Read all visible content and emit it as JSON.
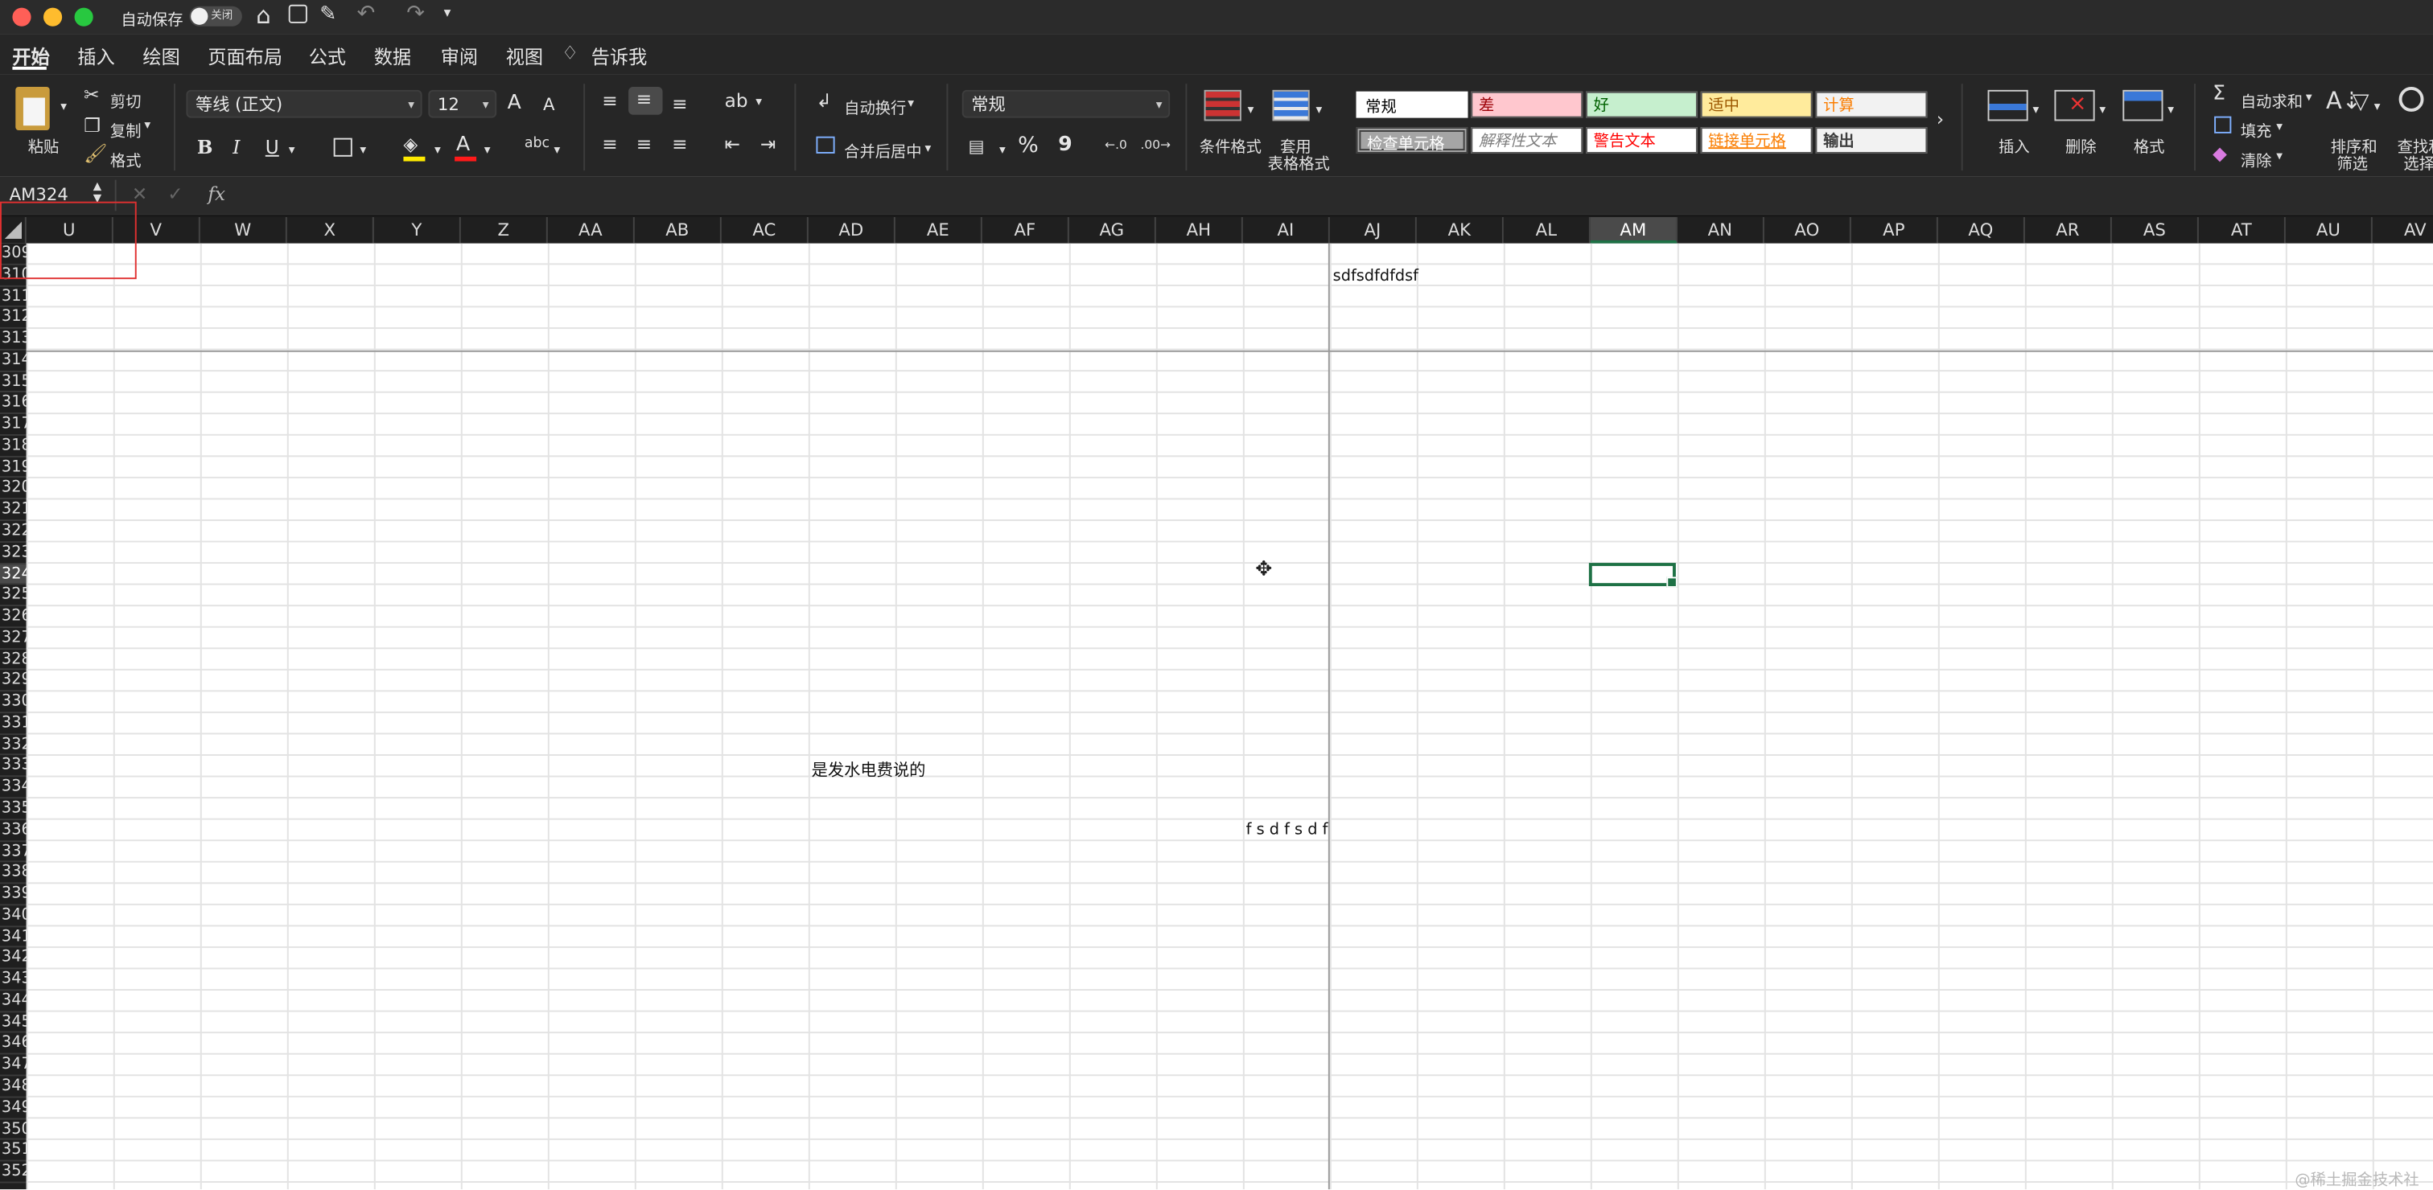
{
  "titlebar": {
    "autosave_label": "自动保存",
    "autosave_state": "关闭",
    "lights": [
      "#ff5f57",
      "#febc2e",
      "#28c840"
    ]
  },
  "tabs": [
    "开始",
    "插入",
    "绘图",
    "页面布局",
    "公式",
    "数据",
    "审阅",
    "视图"
  ],
  "tell_me": "告诉我",
  "clipboard": {
    "paste": "粘贴",
    "cut": "剪切",
    "copy": "复制",
    "format": "格式"
  },
  "font": {
    "name": "等线 (正文)",
    "size": "12",
    "bold": "B",
    "italic": "I",
    "underline": "U",
    "grow": "A",
    "shrink": "A"
  },
  "alignment": {
    "wrap": "自动换行",
    "merge": "合并后居中"
  },
  "number": {
    "format": "常规",
    "percent": "%",
    "comma": "9"
  },
  "styles_group": {
    "conditional": "条件格式",
    "table_format_1": "套用",
    "table_format_2": "表格格式",
    "cells": [
      {
        "label": "常规",
        "bg": "#ffffff",
        "fg": "#000000"
      },
      {
        "label": "差",
        "bg": "#ffc7ce",
        "fg": "#9c0006"
      },
      {
        "label": "好",
        "bg": "#c6efce",
        "fg": "#006100"
      },
      {
        "label": "适中",
        "bg": "#ffeb9c",
        "fg": "#9c5700"
      },
      {
        "label": "计算",
        "bg": "#f2f2f2",
        "fg": "#fa7d00"
      },
      {
        "label": "检查单元格",
        "bg": "#a5a5a5",
        "fg": "#ffffff"
      },
      {
        "label": "解释性文本",
        "bg": "#ffffff",
        "fg": "#7f7f7f"
      },
      {
        "label": "警告文本",
        "bg": "#ffffff",
        "fg": "#ff0000"
      },
      {
        "label": "链接单元格",
        "bg": "#ffffff",
        "fg": "#fa7d00"
      },
      {
        "label": "输出",
        "bg": "#f2f2f2",
        "fg": "#3f3f3f"
      }
    ]
  },
  "cells_group": {
    "insert": "插入",
    "delete": "删除",
    "format": "格式"
  },
  "editing": {
    "autosum": "自动求和",
    "fill": "填充",
    "clear": "清除",
    "sort1": "排序和",
    "sort2": "筛选",
    "find1": "查找和",
    "find2": "选择"
  },
  "formula_bar": {
    "name_box": "AM324",
    "fx": "fx",
    "cancel": "✕",
    "enter": "✓"
  },
  "columns": [
    "U",
    "V",
    "W",
    "X",
    "Y",
    "Z",
    "AA",
    "AB",
    "AC",
    "AD",
    "AE",
    "AF",
    "AG",
    "AH",
    "AI",
    "AJ",
    "AK",
    "AL",
    "AM",
    "AN",
    "AO",
    "AP",
    "AQ",
    "AR",
    "AS",
    "AT",
    "AU",
    "AV"
  ],
  "selected_column": "AM",
  "rows": [
    "309",
    "310",
    "311",
    "312",
    "313",
    "314",
    "315",
    "316",
    "317",
    "318",
    "319",
    "320",
    "321",
    "322",
    "323",
    "324",
    "325",
    "326",
    "327",
    "328",
    "329",
    "330",
    "331",
    "332",
    "333",
    "334",
    "335",
    "336",
    "337",
    "338",
    "339",
    "340",
    "341",
    "342",
    "343",
    "344",
    "345",
    "346",
    "347",
    "348",
    "349",
    "350",
    "351",
    "352"
  ],
  "selected_row": "324",
  "cell_values": [
    {
      "ref": "AJ310",
      "text": "sdfsdfdfdsf"
    },
    {
      "ref": "AD333",
      "text": "是发水电费说的"
    },
    {
      "ref": "AI336",
      "text": "f s d f s d f"
    }
  ],
  "watermark": "@稀土掘金技术社区",
  "colors": {
    "chrome": "#262626",
    "accent": "#1e7145",
    "selection_marker": "#e03030"
  }
}
